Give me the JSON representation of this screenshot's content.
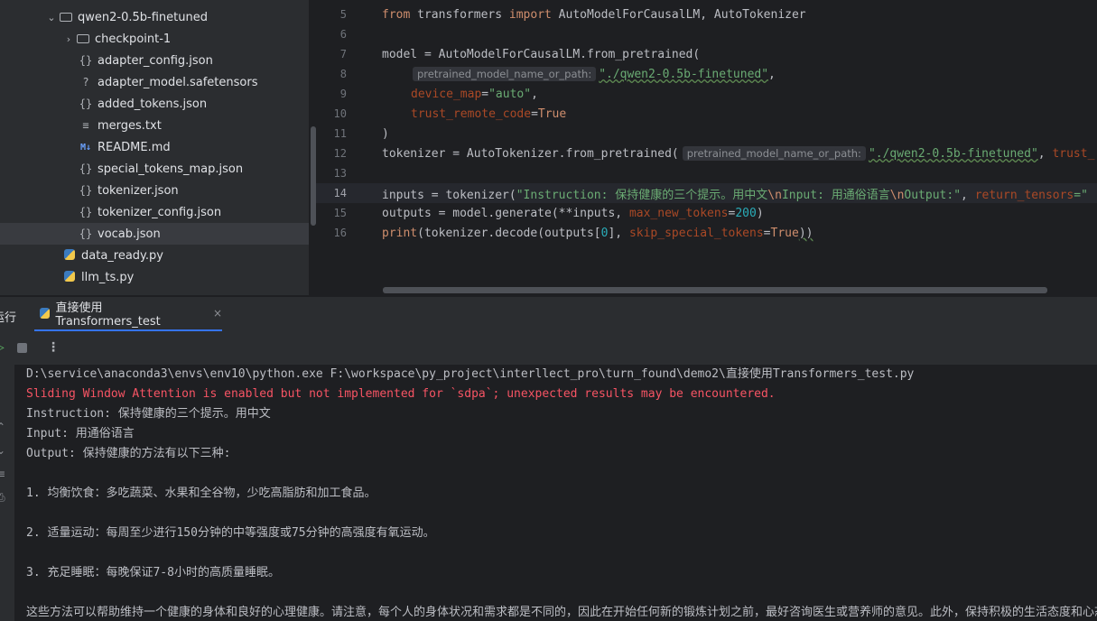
{
  "tree": {
    "items": [
      {
        "label": "qwen2-0.5b-finetuned",
        "icon": "folder-icon",
        "chevron": "⌄"
      },
      {
        "label": "checkpoint-1",
        "icon": "folder-icon",
        "chevron": "›"
      },
      {
        "label": "adapter_config.json",
        "icon": "json-icon",
        "glyph": "{}"
      },
      {
        "label": "adapter_model.safetensors",
        "icon": "unknown-file-icon",
        "glyph": "?"
      },
      {
        "label": "added_tokens.json",
        "icon": "json-icon",
        "glyph": "{}"
      },
      {
        "label": "merges.txt",
        "icon": "text-file-icon",
        "glyph": "≡"
      },
      {
        "label": "README.md",
        "icon": "markdown-icon",
        "glyph": "M↓"
      },
      {
        "label": "special_tokens_map.json",
        "icon": "json-icon",
        "glyph": "{}"
      },
      {
        "label": "tokenizer.json",
        "icon": "json-icon",
        "glyph": "{}"
      },
      {
        "label": "tokenizer_config.json",
        "icon": "json-icon",
        "glyph": "{}"
      },
      {
        "label": "vocab.json",
        "icon": "json-icon",
        "glyph": "{}"
      },
      {
        "label": "data_ready.py",
        "icon": "python-file-icon"
      },
      {
        "label": "llm_ts.py",
        "icon": "python-file-icon"
      }
    ]
  },
  "editor": {
    "line_numbers": [
      "5",
      "6",
      "7",
      "8",
      "9",
      "10",
      "11",
      "12",
      "13",
      "14",
      "15",
      "16"
    ],
    "hints": {
      "pretrained": "pretrained_model_name_or_path:"
    },
    "code": {
      "l5": {
        "from": "from",
        "mod": " transformers ",
        "import": "import",
        "names": " AutoModelForCausalLM, AutoTokenizer"
      },
      "l7": {
        "text": "model = AutoModelForCausalLM.from_pretrained("
      },
      "l8": {
        "str": "\"./qwen2-0.5b-finetuned\"",
        "tail": ","
      },
      "l9": {
        "param": "device_map",
        "eq": "=",
        "str": "\"auto\"",
        "tail": ","
      },
      "l10": {
        "param": "trust_remote_code",
        "eq": "=",
        "kw": "True"
      },
      "l11": {
        "text": ")"
      },
      "l12": {
        "head": "tokenizer = AutoTokenizer.from_pretrained(",
        "str": "\"./qwen2-0.5b-finetuned\"",
        "mid": ", ",
        "param": "trust_"
      },
      "l14": {
        "head": "inputs = tokenizer(",
        "str1": "\"Instruction: 保持健康的三个提示。用中文",
        "esc1": "\\n",
        "str2": "Input: 用通俗语言",
        "esc2": "\\n",
        "str3": "Output:\"",
        "mid": ", ",
        "param": "return_tensors",
        "eq": "=\""
      },
      "l15": {
        "head": "outputs = model.generate(**inputs, ",
        "param": "max_new_tokens",
        "eq": "=",
        "num": "200",
        "tail": ")"
      },
      "l16": {
        "print": "print",
        "head": "(tokenizer.decode(outputs[",
        "num": "0",
        "mid": "], ",
        "param": "skip_special_tokens",
        "eq": "=",
        "kw": "True",
        "tail": "))"
      }
    }
  },
  "run": {
    "title": "运行",
    "tab_label": "直接使用Transformers_test",
    "close_glyph": "×",
    "console": [
      {
        "text": "D:\\service\\anaconda3\\envs\\env10\\python.exe F:\\workspace\\py_project\\interllect_pro\\turn_found\\demo2\\直接使用Transformers_test.py",
        "type": "normal"
      },
      {
        "text": "Sliding Window Attention is enabled but not implemented for `sdpa`; unexpected results may be encountered.",
        "type": "err"
      },
      {
        "text": "Instruction: 保持健康的三个提示。用中文",
        "type": "normal"
      },
      {
        "text": "Input: 用通俗语言",
        "type": "normal"
      },
      {
        "text": "Output: 保持健康的方法有以下三种:",
        "type": "normal"
      },
      {
        "text": "",
        "type": "normal"
      },
      {
        "text": "1. 均衡饮食：多吃蔬菜、水果和全谷物，少吃高脂肪和加工食品。",
        "type": "normal"
      },
      {
        "text": "",
        "type": "normal"
      },
      {
        "text": "2. 适量运动：每周至少进行150分钟的中等强度或75分钟的高强度有氧运动。",
        "type": "normal"
      },
      {
        "text": "",
        "type": "normal"
      },
      {
        "text": "3. 充足睡眠：每晚保证7-8小时的高质量睡眠。",
        "type": "normal"
      },
      {
        "text": "",
        "type": "normal"
      },
      {
        "text": "这些方法可以帮助维持一个健康的身体和良好的心理健康。请注意，每个人的身体状况和需求都是不同的，因此在开始任何新的锻炼计划之前，最好咨询医生或营养师的意见。此外，保持积极的生活态度和心态",
        "type": "normal"
      }
    ]
  },
  "colors": {
    "accent": "#3574f0",
    "error": "#f75464",
    "string": "#6aab73",
    "keyword": "#cf8e6d",
    "param": "#aa4926",
    "number": "#2aacb8"
  }
}
